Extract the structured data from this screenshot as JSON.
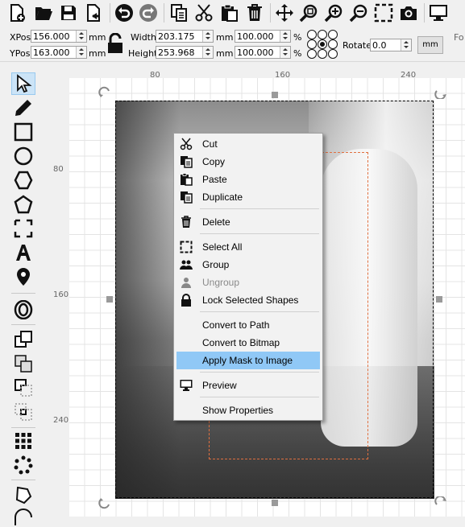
{
  "toolbar": {
    "buttons": [
      "new-document-icon",
      "open-folder-icon",
      "save-icon",
      "export-icon",
      "undo-icon",
      "redo-icon",
      "copy-icon",
      "cut-icon",
      "paste-icon",
      "delete-icon",
      "move-icon",
      "zoom-selection-icon",
      "zoom-in-icon",
      "zoom-out-icon",
      "select-area-icon",
      "camera-icon",
      "monitor-icon"
    ]
  },
  "props": {
    "xpos_label": "XPos",
    "xpos_value": "156.000",
    "ypos_label": "YPos",
    "ypos_value": "163.000",
    "unit_mm": "mm",
    "width_label": "Width",
    "width_value": "203.175",
    "height_label": "Height",
    "height_value": "253.968",
    "width_pct": "100.000",
    "height_pct": "100.000",
    "pct": "%",
    "rotate_label": "Rotate",
    "rotate_value": "0.0",
    "unit_button": "mm",
    "cut_off": "Fo"
  },
  "ruler": {
    "top": [
      "80",
      "160",
      "240"
    ],
    "left": [
      "80",
      "160",
      "240"
    ]
  },
  "context_menu": {
    "cut": "Cut",
    "copy": "Copy",
    "paste": "Paste",
    "duplicate": "Duplicate",
    "delete": "Delete",
    "select_all": "Select All",
    "group": "Group",
    "ungroup": "Ungroup",
    "lock": "Lock Selected Shapes",
    "convert_path": "Convert to Path",
    "convert_bitmap": "Convert to Bitmap",
    "apply_mask": "Apply Mask to Image",
    "preview": "Preview",
    "show_properties": "Show Properties"
  },
  "colors": {
    "highlight": "#90c8f6",
    "mask_outline": "#e07040"
  }
}
